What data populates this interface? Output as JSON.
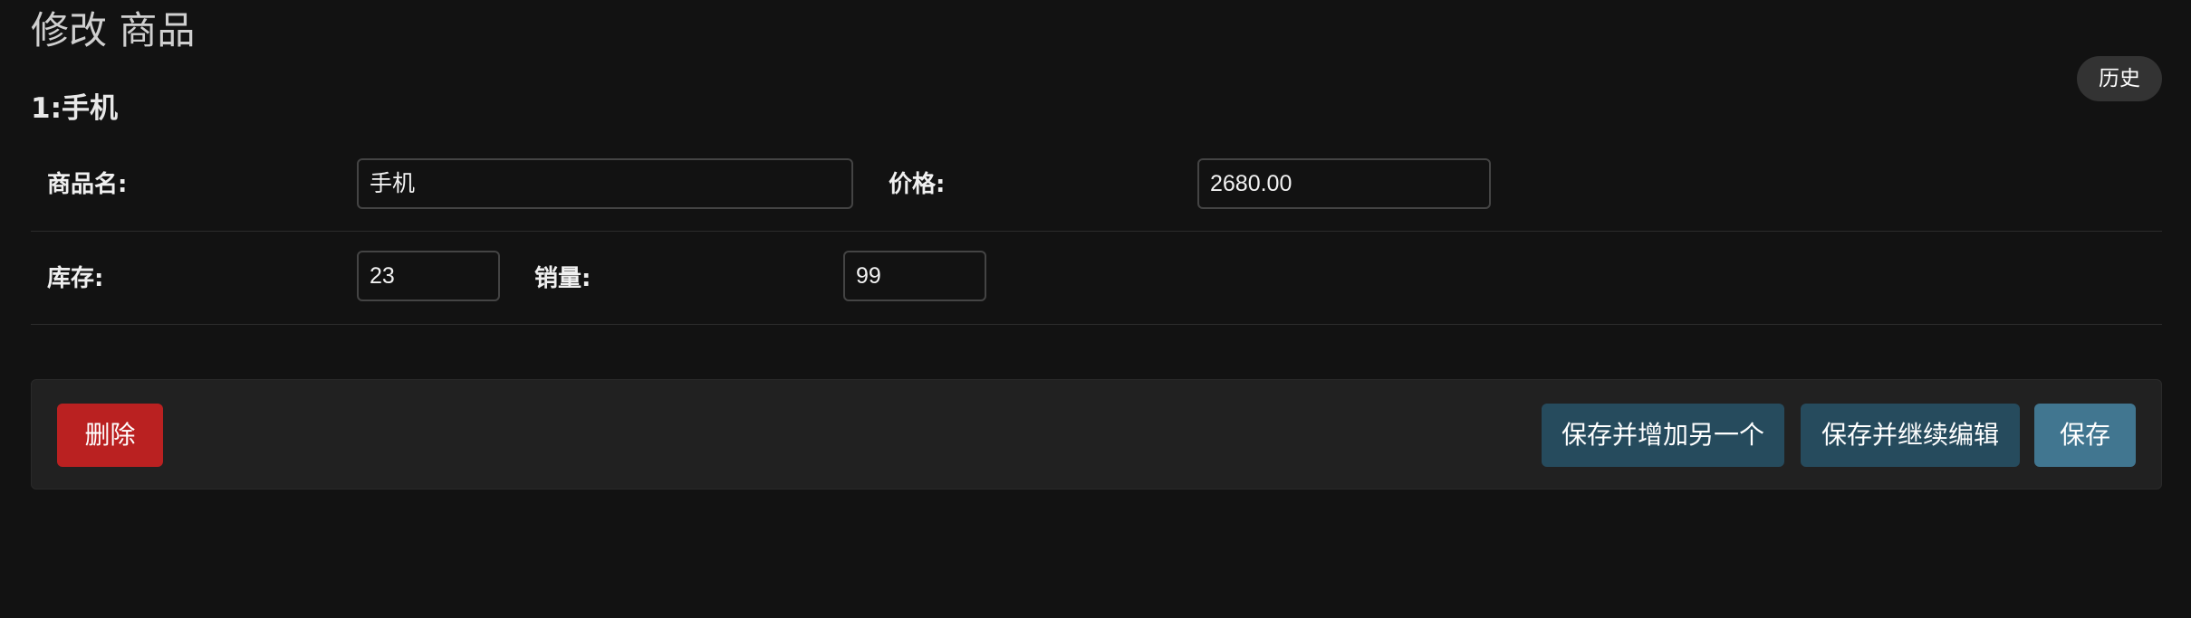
{
  "page": {
    "title": "修改 商品",
    "object_title": "1:手机"
  },
  "tools": {
    "history_label": "历史"
  },
  "form": {
    "name": {
      "label": "商品名:",
      "value": "手机"
    },
    "price": {
      "label": "价格:",
      "value": "2680.00"
    },
    "stock": {
      "label": "库存:",
      "value": "23"
    },
    "sales": {
      "label": "销量:",
      "value": "99"
    }
  },
  "actions": {
    "delete_label": "删除",
    "save_add_another_label": "保存并增加另一个",
    "save_continue_label": "保存并继续编辑",
    "save_label": "保存"
  },
  "colors": {
    "background": "#121212",
    "delete": "#ba2121",
    "secondary_button": "#264b5d",
    "primary_button": "#417690"
  }
}
